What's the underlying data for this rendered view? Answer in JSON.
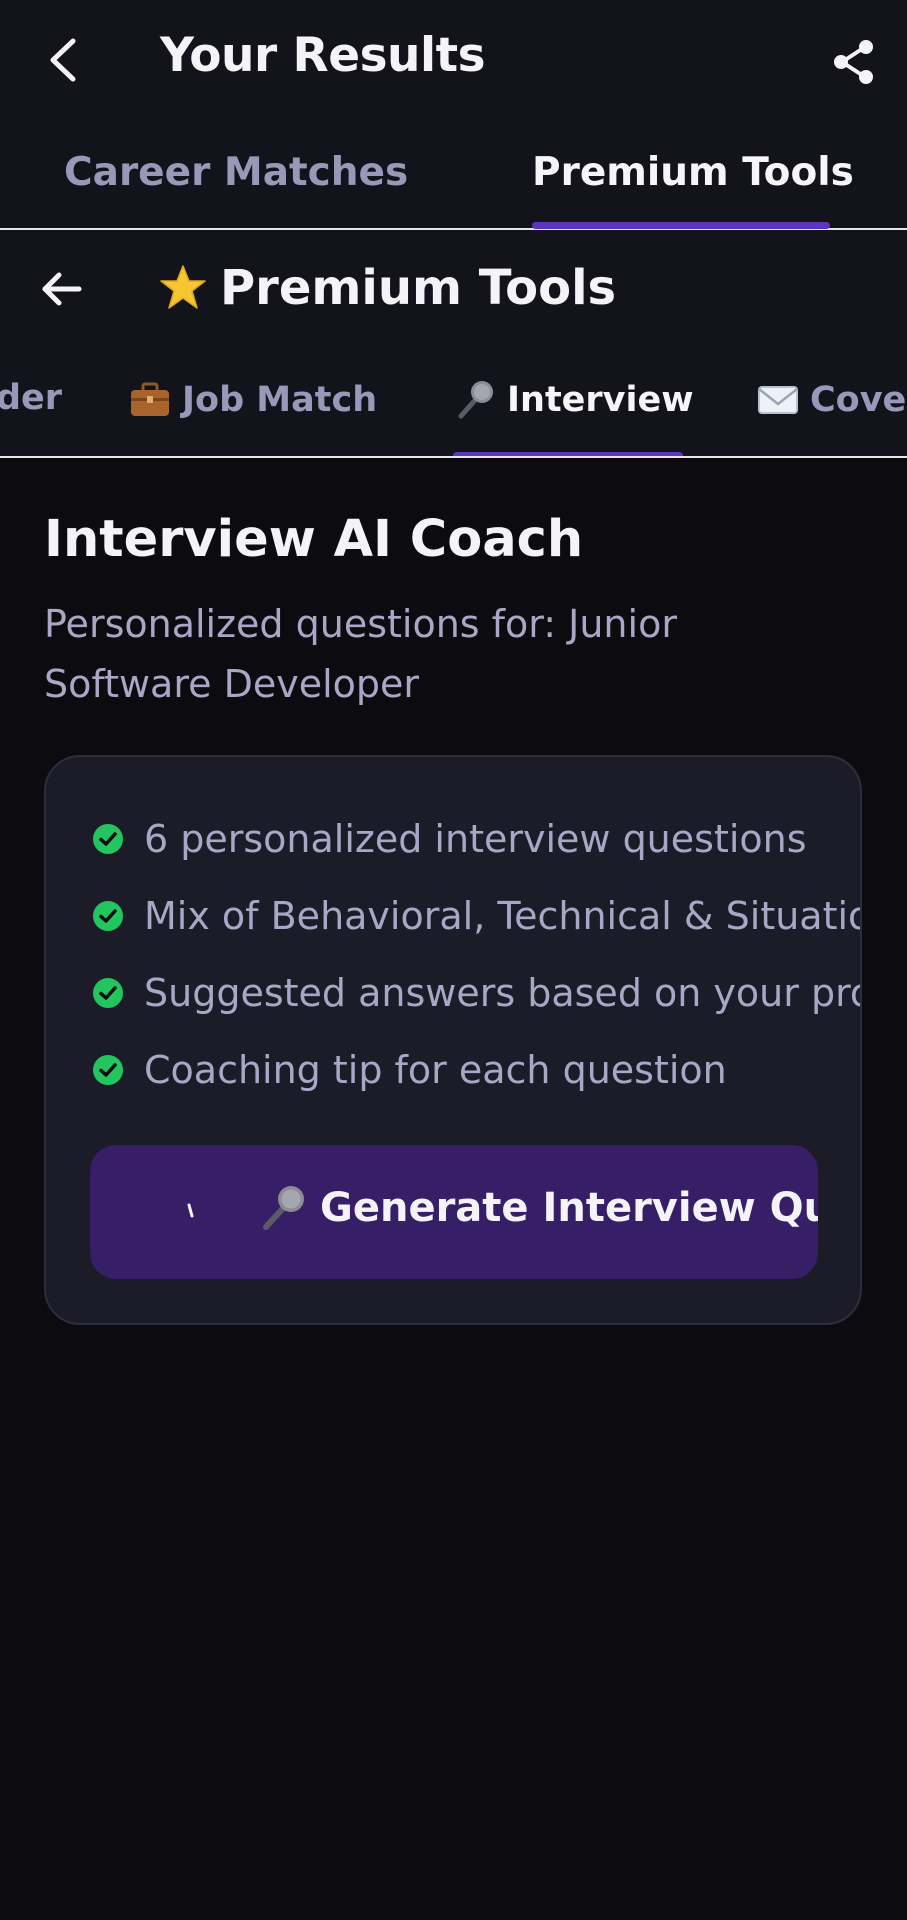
{
  "app_bar": {
    "title": "Your Results"
  },
  "main_tabs": [
    {
      "label": "Career Matches",
      "active": false
    },
    {
      "label": "Premium Tools",
      "active": true
    }
  ],
  "sub_header": {
    "title": "Premium Tools",
    "icon": "star-icon"
  },
  "tool_tabs": [
    {
      "label": "der",
      "icon": null,
      "active": false
    },
    {
      "label": "Job Match",
      "icon": "briefcase-icon",
      "active": false
    },
    {
      "label": "Interview",
      "icon": "microphone-icon",
      "active": true
    },
    {
      "label": "Cove",
      "icon": "envelope-icon",
      "active": false
    }
  ],
  "main": {
    "title": "Interview AI Coach",
    "subtitle": "Personalized questions for: Junior Software Developer",
    "features": [
      "6 personalized interview questions",
      "Mix of Behavioral, Technical & Situation",
      "Suggested answers based on your prof",
      "Coaching tip for each question"
    ],
    "generate_button": "Generate Interview Question"
  },
  "colors": {
    "background": "#0b0b10",
    "header": "#13141b",
    "accent": "#5b36c2",
    "button": "#361f66",
    "check": "#22c55e",
    "muted_text": "#a9a6c6"
  }
}
